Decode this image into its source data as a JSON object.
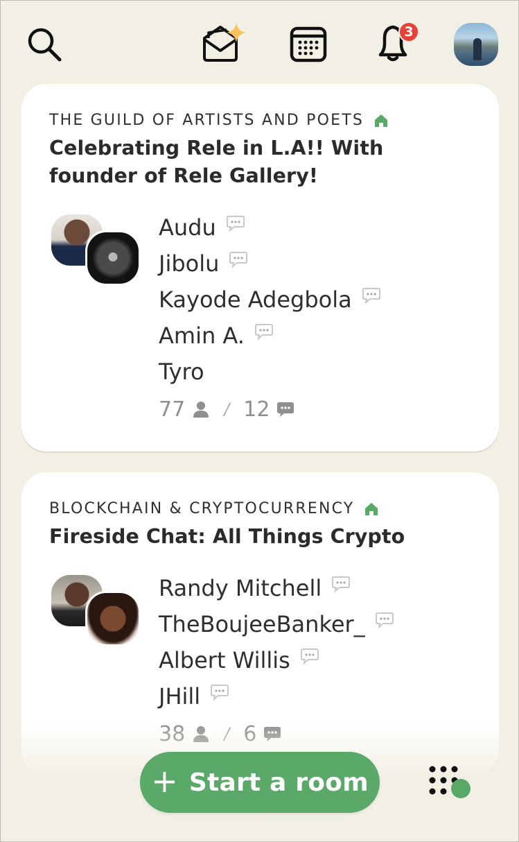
{
  "header": {
    "search_icon": "search-icon",
    "invite_icon": "envelope-sparkle-icon",
    "calendar_icon": "calendar-icon",
    "bell_icon": "bell-icon",
    "notification_count": "3"
  },
  "colors": {
    "background": "#f2efe4",
    "accent_green": "#5aa968",
    "badge_red": "#e8413a",
    "card": "#ffffff"
  },
  "rooms": [
    {
      "club": "THE GUILD OF ARTISTS AND POETS",
      "title": "Celebrating Rele in L.A!! With founder of Rele Gallery!",
      "speakers": [
        "Audu",
        "Jibolu",
        "Kayode Adegbola",
        "Amin A.",
        "Tyro"
      ],
      "listeners": "77",
      "chats": "12"
    },
    {
      "club": "BLOCKCHAIN & CRYPTOCURRENCY",
      "title": "Fireside Chat: All Things Crypto",
      "speakers": [
        "Randy Mitchell",
        "TheBoujeeBanker_",
        "Albert Willis",
        "JHill"
      ],
      "listeners": "38",
      "chats": "6"
    }
  ],
  "footer": {
    "start_room_plus": "+",
    "start_room_label": "Start a room",
    "grid_icon": "dots-grid-icon"
  }
}
